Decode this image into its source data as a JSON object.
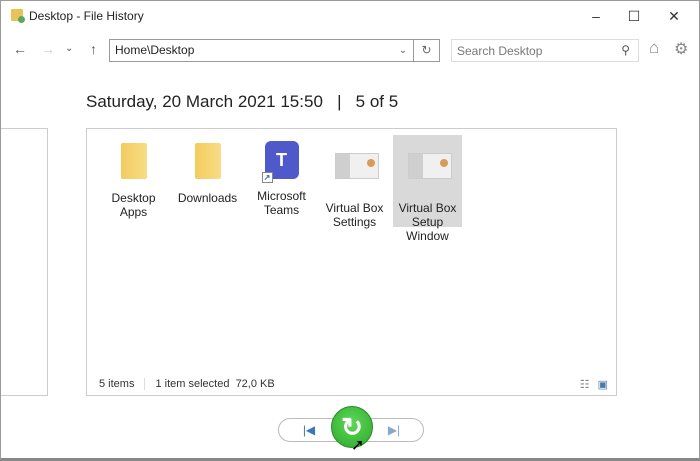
{
  "window": {
    "title": "Desktop - File History",
    "minimize": "–",
    "maximize": "☐",
    "close": "✕"
  },
  "nav": {
    "back": "←",
    "forward": "→",
    "recent": "⌄",
    "up": "↑",
    "address": "Home\\Desktop",
    "dropdown": "⌄",
    "refresh": "↻",
    "search_placeholder": "Search Desktop",
    "search_icon": "⚲",
    "home": "⌂",
    "settings": "⚙"
  },
  "header": {
    "date": "Saturday, 20 March 2021 15:50",
    "separator": "|",
    "position": "5 of 5"
  },
  "items": [
    {
      "label": "Desktop Apps",
      "type": "folder"
    },
    {
      "label": "Downloads",
      "type": "folder"
    },
    {
      "label": "Microsoft Teams",
      "type": "shortcut",
      "glyph": "T",
      "shortcut": "↗"
    },
    {
      "label": "Virtual Box Settings",
      "type": "image"
    },
    {
      "label": "Virtual Box Setup Window",
      "type": "image",
      "selected": true
    }
  ],
  "status": {
    "count": "5 items",
    "selection": "1 item selected  72,0 KB",
    "details_view": "☷",
    "icons_view": "▣"
  },
  "controls": {
    "previous": "|◀",
    "restore": "↻",
    "next": "▶|"
  }
}
